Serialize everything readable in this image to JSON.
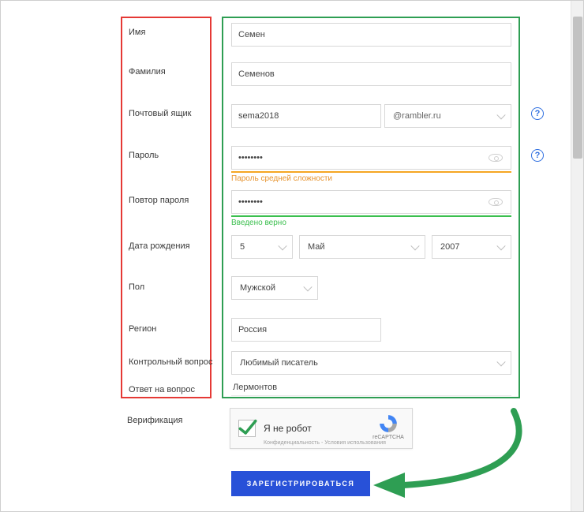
{
  "labels": {
    "first_name": "Имя",
    "last_name": "Фамилия",
    "mailbox": "Почтовый ящик",
    "password": "Пароль",
    "password_repeat": "Повтор пароля",
    "birth_date": "Дата рождения",
    "gender": "Пол",
    "region": "Регион",
    "secret_question": "Контрольный вопрос",
    "secret_answer": "Ответ на вопрос",
    "verification": "Верификация"
  },
  "values": {
    "first_name": "Семен",
    "last_name": "Семенов",
    "mail_local": "sema2018",
    "mail_domain": "@rambler.ru",
    "password_masked": "••••••••",
    "password_repeat_masked": "••••••••",
    "birth_day": "5",
    "birth_month": "Май",
    "birth_year": "2007",
    "gender": "Мужской",
    "region": "Россия",
    "secret_question": "Любимый писатель",
    "secret_answer": "Лермонтов"
  },
  "hints": {
    "password_strength": "Пароль средней сложности",
    "repeat_ok": "Введено верно"
  },
  "captcha": {
    "label": "Я не робот",
    "brand": "reCAPTCHA",
    "fineprint": "Конфиденциальность - Условия использования"
  },
  "buttons": {
    "submit": "ЗАРЕГИСТРИРОВАТЬСЯ"
  },
  "help_glyph": "?"
}
